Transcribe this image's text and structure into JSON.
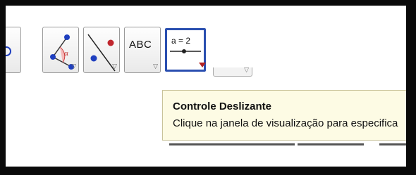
{
  "toolbar": {
    "tools": [
      {
        "name": "partial-tool",
        "icon": "circle-tool-icon"
      },
      {
        "name": "angle-tool",
        "icon": "angle-icon",
        "glyph": "α"
      },
      {
        "name": "reflect-tool",
        "icon": "reflect-line-icon"
      },
      {
        "name": "text-tool",
        "icon": "text-icon",
        "label": "ABC"
      },
      {
        "name": "slider-tool",
        "icon": "slider-icon",
        "label": "a = 2",
        "selected": true
      }
    ],
    "accent": "#2a4fb0"
  },
  "tooltip": {
    "title": "Controle Deslizante",
    "description": "Clique na janela de visualização para especifica"
  },
  "colors": {
    "tooltip_bg": "#fdfbe4",
    "selected_border": "#2a4fb0",
    "point_blue": "#1f3fbf",
    "point_red": "#c0262d"
  }
}
